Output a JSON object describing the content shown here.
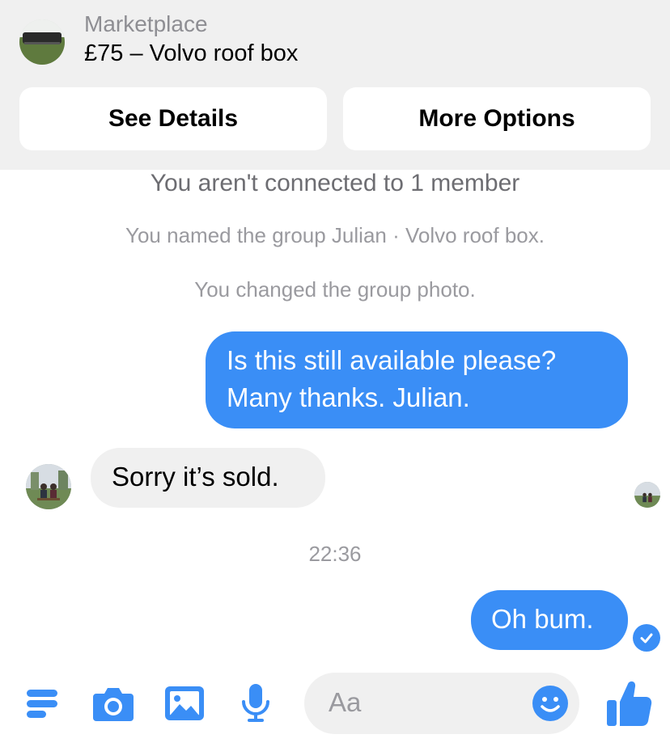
{
  "marketplace": {
    "label": "Marketplace",
    "title": "£75 – Volvo roof box",
    "see_details": "See Details",
    "more_options": "More Options"
  },
  "notices": {
    "connection": "You aren't connected to 1 member",
    "named": "You named the group Julian · Volvo roof box.",
    "photo": "You changed the group photo.",
    "timestamp": "22:36"
  },
  "messages": [
    {
      "direction": "outgoing",
      "text": "Is this still available please? Many thanks. Julian."
    },
    {
      "direction": "incoming",
      "text": "Sorry it’s sold."
    },
    {
      "direction": "outgoing",
      "text": "Oh bum."
    }
  ],
  "composer": {
    "placeholder": "Aa",
    "icons": [
      "menu-icon",
      "camera-icon",
      "image-icon",
      "microphone-icon",
      "emoji-icon",
      "like-icon"
    ]
  },
  "colors": {
    "accent": "#3a8ef6",
    "header_bg": "#f0f0f0",
    "incoming_bubble": "#f0f0f0"
  }
}
